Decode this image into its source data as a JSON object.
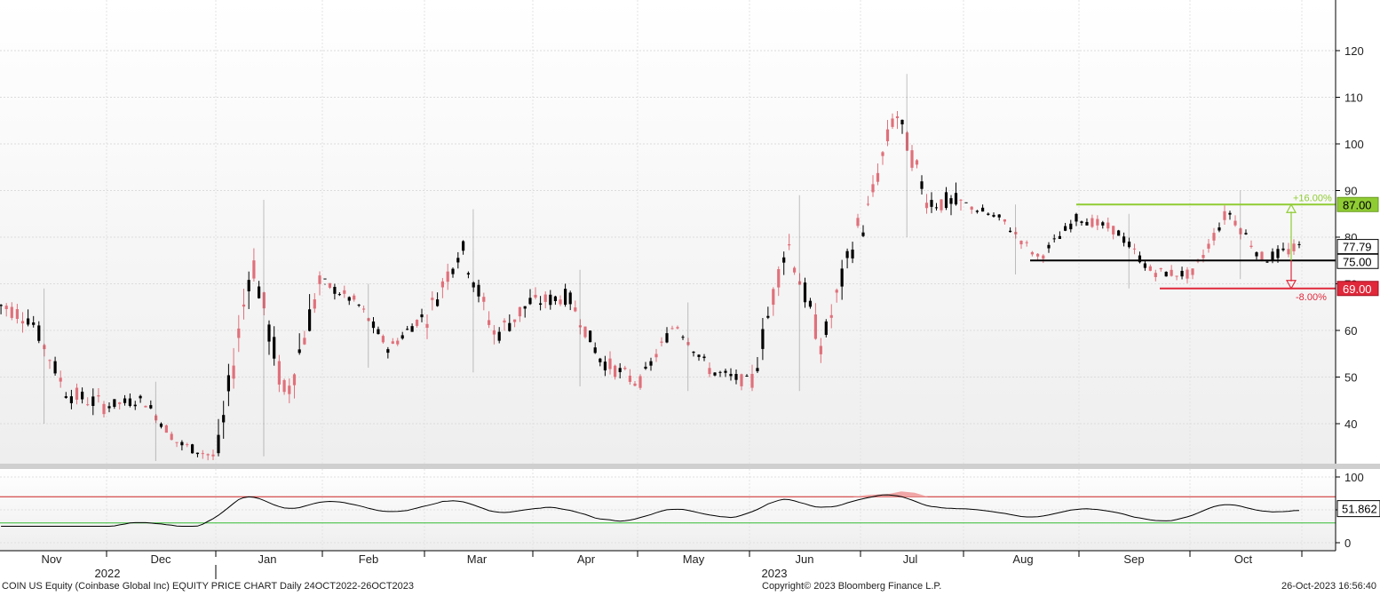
{
  "footer": {
    "left": "COIN US Equity (Coinbase Global Inc) EQUITY PRICE CHART  Daily 24OCT2022-26OCT2023",
    "center": "Copyright© 2023 Bloomberg Finance L.P.",
    "right": "26-Oct-2023 16:56:40"
  },
  "colors": {
    "up": "#000000",
    "down": "#e0707a",
    "green": "#8fcc33",
    "red": "#e0283a",
    "black": "#000000",
    "rsi_line": "#000000",
    "rsi_upper": "#cc2222",
    "rsi_lower": "#33bb33",
    "rsi_fill": "#f0a6a6"
  },
  "chart_data": [
    {
      "type": "candlestick",
      "title": "COIN US Equity (Coinbase Global Inc) EQUITY PRICE CHART",
      "frequency": "Daily",
      "date_range": "24OCT2022-26OCT2023",
      "x_month_labels": [
        "Nov",
        "Dec",
        "Jan",
        "Feb",
        "Mar",
        "Apr",
        "May",
        "Jun",
        "Jul",
        "Aug",
        "Sep",
        "Oct"
      ],
      "x_year_labels": [
        "2022",
        "2023"
      ],
      "y_ticks": [
        40,
        50,
        60,
        70,
        80,
        90,
        100,
        110,
        120
      ],
      "ylim": [
        30,
        130
      ],
      "grid": true,
      "monthly_ohlc": [
        {
          "month": "Nov 2022",
          "open": 66,
          "high": 69,
          "low": 40,
          "close": 44
        },
        {
          "month": "Dec 2022",
          "open": 44,
          "high": 49,
          "low": 32,
          "close": 33
        },
        {
          "month": "Jan 2023",
          "open": 34,
          "high": 88,
          "low": 33,
          "close": 70
        },
        {
          "month": "Feb 2023",
          "open": 70,
          "high": 70,
          "low": 52,
          "close": 63
        },
        {
          "month": "Mar 2023",
          "open": 63,
          "high": 86,
          "low": 51,
          "close": 66
        },
        {
          "month": "Apr 2023",
          "open": 66,
          "high": 73,
          "low": 48,
          "close": 49
        },
        {
          "month": "May 2023",
          "open": 49,
          "high": 66,
          "low": 47,
          "close": 49
        },
        {
          "month": "Jun 2023",
          "open": 49,
          "high": 89,
          "low": 47,
          "close": 82
        },
        {
          "month": "Jul 2023",
          "open": 82,
          "high": 115,
          "low": 80,
          "close": 87
        },
        {
          "month": "Aug 2023",
          "open": 87,
          "high": 87,
          "low": 72,
          "close": 84
        },
        {
          "month": "Sep 2023",
          "open": 84,
          "high": 85,
          "low": 69,
          "close": 72
        },
        {
          "month": "Oct 2023",
          "open": 72,
          "high": 90,
          "low": 71,
          "close": 77.79
        }
      ],
      "last_price": 77.79,
      "horizontal_lines": [
        {
          "value": 87.0,
          "label": "87.00",
          "color": "green"
        },
        {
          "value": 75.0,
          "label": "75.00",
          "color": "black"
        },
        {
          "value": 69.0,
          "label": "69.00",
          "color": "red"
        }
      ],
      "annotations": [
        {
          "text": "+16.00%",
          "color": "green"
        },
        {
          "text": "-8.00%",
          "color": "red"
        }
      ]
    },
    {
      "type": "line",
      "title": "RSI",
      "y_ticks": [
        0,
        50,
        100
      ],
      "ylim": [
        -10,
        110
      ],
      "reference_lines": [
        {
          "value": 70,
          "color": "red"
        },
        {
          "value": 30,
          "color": "green"
        }
      ],
      "last_value": 51.862,
      "last_label": "51.862"
    }
  ]
}
